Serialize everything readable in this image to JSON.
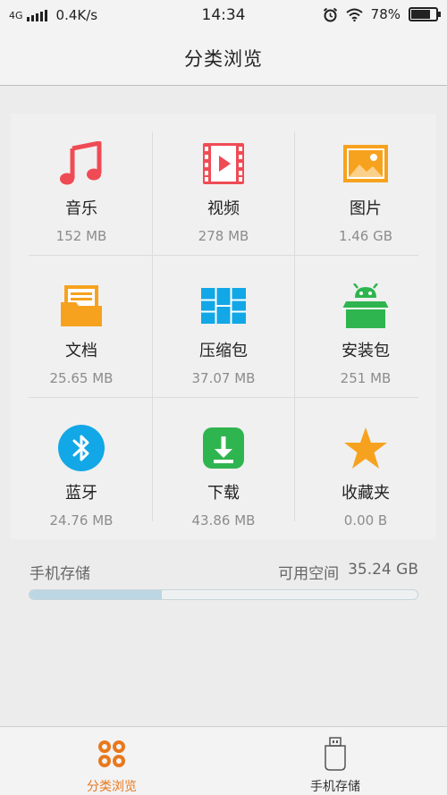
{
  "status_bar": {
    "network": "4G",
    "speed": "0.4K/s",
    "time": "14:34",
    "battery": "78%",
    "battery_level": 0.78
  },
  "header": {
    "title": "分类浏览"
  },
  "categories": [
    {
      "label": "音乐",
      "size": "152 MB",
      "icon": "music-note-icon",
      "color": "#ef4b55"
    },
    {
      "label": "视频",
      "size": "278 MB",
      "icon": "video-icon",
      "color": "#ef4b55"
    },
    {
      "label": "图片",
      "size": "1.46 GB",
      "icon": "image-icon",
      "color": "#f7a21e"
    },
    {
      "label": "文档",
      "size": "25.65 MB",
      "icon": "folder-document-icon",
      "color": "#f7a21e"
    },
    {
      "label": "压缩包",
      "size": "37.07 MB",
      "icon": "archive-icon",
      "color": "#12a7e6"
    },
    {
      "label": "安装包",
      "size": "251 MB",
      "icon": "android-package-icon",
      "color": "#2fb54f"
    },
    {
      "label": "蓝牙",
      "size": "24.76 MB",
      "icon": "bluetooth-icon",
      "color": "#12a7e6"
    },
    {
      "label": "下载",
      "size": "43.86 MB",
      "icon": "download-icon",
      "color": "#2fb54f"
    },
    {
      "label": "收藏夹",
      "size": "0.00 B",
      "icon": "star-icon",
      "color": "#f7a21e"
    }
  ],
  "storage": {
    "label": "手机存储",
    "free_label": "可用空间",
    "free_value": "35.24 GB",
    "used_fraction": 0.34
  },
  "bottom_nav": [
    {
      "label": "分类浏览",
      "icon": "category-grid-icon",
      "active": true
    },
    {
      "label": "手机存储",
      "icon": "phone-storage-icon",
      "active": false
    }
  ],
  "colors": {
    "accent": "#e8781e"
  }
}
